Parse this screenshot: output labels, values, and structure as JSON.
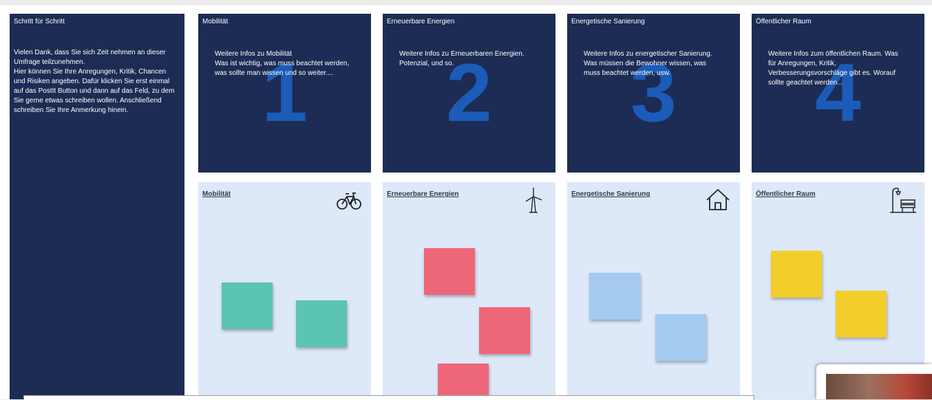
{
  "intro": {
    "title": "Schritt für Schritt",
    "text": "Vielen Dank, dass Sie sich Zeit nehmen an dieser Umfrage teilzunehmen.\nHier können Sie Ihre Anregungen, Kritik, Chancen und Risiken angeben. Dafür klicken Sie erst einmal auf das PostIt Button und dann auf das Feld, zu dem Sie gerne etwas schreiben wollen. Anschließend schreiben Sie Ihre Anmerkung hinein."
  },
  "cards": [
    {
      "title": "Mobilität",
      "number": "1",
      "text": "Weitere Infos zu Mobilität\nWas ist wichtig, was muss beachtet werden, was sollte man wissen und so weiter...."
    },
    {
      "title": "Erneuerbare Energien",
      "number": "2",
      "text": "Weitere Infos zu Erneuerbaren Energien. Potenzial, und so."
    },
    {
      "title": "Energetische Sanierung",
      "number": "3",
      "text": "Weitere Infos zu energetischer Sanierung. Was müssen die Bewohner wissen, was muss beachtet werden, usw."
    },
    {
      "title": "Öffentlicher Raum",
      "number": "4",
      "text": "Weitere Infos zum öffentlichen Raum. Was für Anregungen, Kritik, Verbesserungsvorschläge gibt es. Worauf sollte geachtet werden..."
    }
  ],
  "boards": [
    {
      "title": "Mobilität",
      "icon": "bicycle-icon",
      "note_color": "#5cc4b4",
      "note_count": 2
    },
    {
      "title": "Erneuerbare Energien",
      "icon": "wind-turbine-icon",
      "note_color": "#ee6778",
      "note_count": 3
    },
    {
      "title": "Energetische Sanierung",
      "icon": "house-icon",
      "note_color": "#a4cbef",
      "note_count": 2
    },
    {
      "title": "Öffentlicher Raum",
      "icon": "street-lamp-bench-icon",
      "note_color": "#f3cd2a",
      "note_count": 2
    }
  ],
  "colors": {
    "card_bg": "#1c2c54",
    "card_number": "#1c5bb8",
    "board_bg": "#dde8f9"
  }
}
